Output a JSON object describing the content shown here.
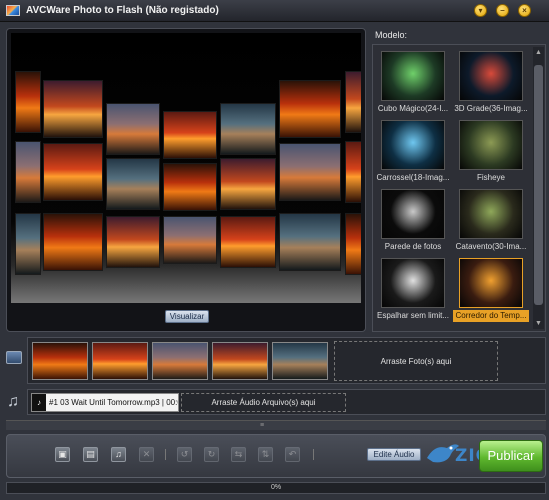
{
  "app": {
    "title": "AVCWare Photo to Flash (Não registado)",
    "window_buttons": [
      "▾",
      "–",
      "×"
    ]
  },
  "preview": {
    "visualize_label": "Visualizar"
  },
  "templates": {
    "label": "Modelo:",
    "items": [
      {
        "label": "Cubo Mágico(24-I...",
        "selected": false
      },
      {
        "label": "3D Grade(36-Imag...",
        "selected": false
      },
      {
        "label": "Carrossel(18-Imag...",
        "selected": false
      },
      {
        "label": "Fisheye",
        "selected": false
      },
      {
        "label": "Parede de fotos",
        "selected": false
      },
      {
        "label": "Catavento(30-Ima...",
        "selected": false
      },
      {
        "label": "Espalhar sem limit...",
        "selected": false
      },
      {
        "label": "Corredor do Temp...",
        "selected": true
      }
    ]
  },
  "photos": {
    "drop_label": "Arraste Foto(s) aqui",
    "count": 5
  },
  "audio": {
    "track": "#1 03 Wait Until Tomorrow.mp3 | 00:04",
    "drop_label": "Arraste Áudio Arquivo(s) aqui"
  },
  "toolbar": {
    "tools": [
      {
        "name": "add-photo-tool",
        "glyph": "▣",
        "enabled": true
      },
      {
        "name": "add-photos-tool",
        "glyph": "▤",
        "enabled": true
      },
      {
        "name": "add-audio-tool",
        "glyph": "♫",
        "enabled": true
      },
      {
        "name": "delete-tool",
        "glyph": "✕",
        "enabled": false
      },
      {
        "name": "rotate-left-tool",
        "glyph": "↺",
        "enabled": false
      },
      {
        "name": "rotate-right-tool",
        "glyph": "↻",
        "enabled": false
      },
      {
        "name": "flip-horizontal-tool",
        "glyph": "⇆",
        "enabled": false
      },
      {
        "name": "flip-vertical-tool",
        "glyph": "⇅",
        "enabled": false
      },
      {
        "name": "undo-tool",
        "glyph": "↶",
        "enabled": false
      }
    ],
    "edit_audio_label": "Edite Áudio",
    "publish_label": "Publicar",
    "logo_text": "ZIGG"
  },
  "progress": {
    "percent": 0,
    "label": "0%"
  },
  "colors": {
    "accent_selected": "#e8a126",
    "publish_green": "#5fb82e"
  }
}
